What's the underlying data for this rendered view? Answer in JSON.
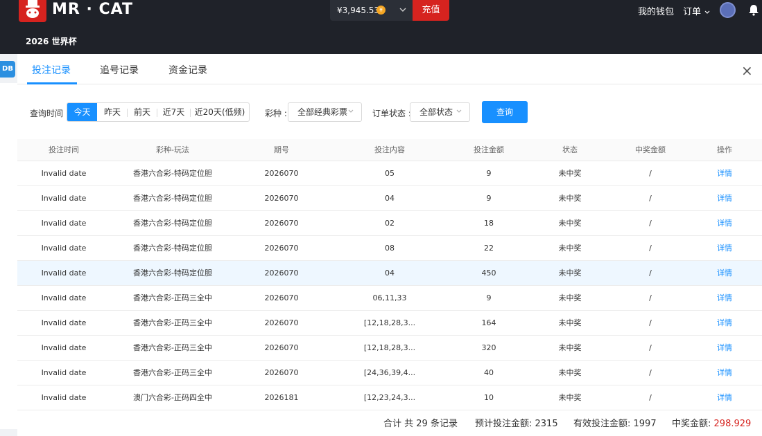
{
  "header": {
    "brand": "MR · CAT",
    "subnav": "2026 世界杯",
    "balance": "¥3,945.53",
    "recharge_label": "充值",
    "wallet_label": "我的钱包",
    "orders_label": "订单"
  },
  "background": {
    "db_badge": "DB"
  },
  "modal": {
    "tabs": [
      {
        "label": "投注记录"
      },
      {
        "label": "追号记录"
      },
      {
        "label": "资金记录"
      }
    ],
    "close_glyph": "×",
    "filters": {
      "time_label": "查询时间 :",
      "time_options": [
        "今天",
        "昨天",
        "前天",
        "近7天",
        "近20天(低频)"
      ],
      "lottery_label": "彩种 :",
      "lottery_value": "全部经典彩票",
      "status_label": "订单状态 :",
      "status_value": "全部状态",
      "query_label": "查询"
    },
    "table": {
      "columns": [
        "投注时间",
        "彩种-玩法",
        "期号",
        "投注内容",
        "投注金额",
        "状态",
        "中奖金额",
        "操作"
      ],
      "rows": [
        {
          "time": "Invalid date",
          "game": "香港六合彩-特码定位胆",
          "issue": "2026070",
          "content": "05",
          "amount": "9",
          "status": "未中奖",
          "win": "/",
          "action": "详情"
        },
        {
          "time": "Invalid date",
          "game": "香港六合彩-特码定位胆",
          "issue": "2026070",
          "content": "04",
          "amount": "9",
          "status": "未中奖",
          "win": "/",
          "action": "详情"
        },
        {
          "time": "Invalid date",
          "game": "香港六合彩-特码定位胆",
          "issue": "2026070",
          "content": "02",
          "amount": "18",
          "status": "未中奖",
          "win": "/",
          "action": "详情"
        },
        {
          "time": "Invalid date",
          "game": "香港六合彩-特码定位胆",
          "issue": "2026070",
          "content": "08",
          "amount": "22",
          "status": "未中奖",
          "win": "/",
          "action": "详情"
        },
        {
          "time": "Invalid date",
          "game": "香港六合彩-特码定位胆",
          "issue": "2026070",
          "content": "04",
          "amount": "450",
          "status": "未中奖",
          "win": "/",
          "action": "详情"
        },
        {
          "time": "Invalid date",
          "game": "香港六合彩-正码三全中",
          "issue": "2026070",
          "content": "06,11,33",
          "amount": "9",
          "status": "未中奖",
          "win": "/",
          "action": "详情"
        },
        {
          "time": "Invalid date",
          "game": "香港六合彩-正码三全中",
          "issue": "2026070",
          "content": "[12,18,28,3...",
          "amount": "164",
          "status": "未中奖",
          "win": "/",
          "action": "详情"
        },
        {
          "time": "Invalid date",
          "game": "香港六合彩-正码三全中",
          "issue": "2026070",
          "content": "[12,18,28,3...",
          "amount": "320",
          "status": "未中奖",
          "win": "/",
          "action": "详情"
        },
        {
          "time": "Invalid date",
          "game": "香港六合彩-正码三全中",
          "issue": "2026070",
          "content": "[24,36,39,4...",
          "amount": "40",
          "status": "未中奖",
          "win": "/",
          "action": "详情"
        },
        {
          "time": "Invalid date",
          "game": "澳门六合彩-正码四全中",
          "issue": "2026181",
          "content": "[12,23,24,3...",
          "amount": "10",
          "status": "未中奖",
          "win": "/",
          "action": "详情"
        }
      ]
    },
    "footer": {
      "total_records": "合计 共 29 条记录",
      "expected_bet": "预计投注金额: 2315",
      "effective_bet": "有效投注金额: 1997",
      "win_label": "中奖金额:",
      "win_value": "298.929"
    }
  },
  "colors": {
    "brand_red": "#d6231f",
    "accent_blue": "#1890ff",
    "header_bg": "#1f2229"
  }
}
